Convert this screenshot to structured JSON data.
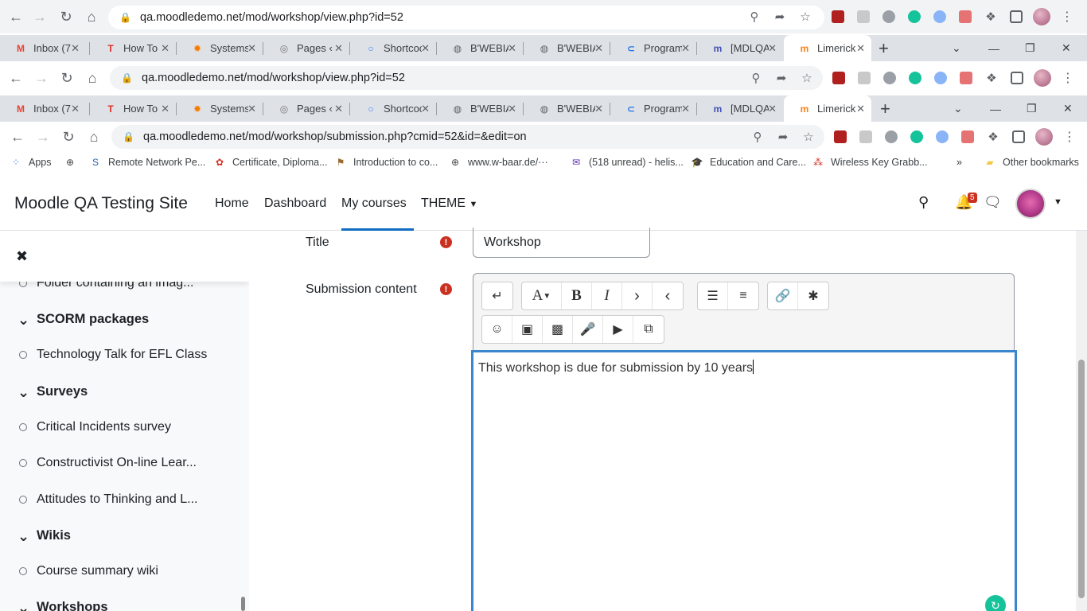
{
  "browser": {
    "row1": {
      "url": "qa.moodledemo.net/mod/workshop/view.php?id=52"
    },
    "row2": {
      "url": "qa.moodledemo.net/mod/workshop/view.php?id=52"
    },
    "row3": {
      "url": "qa.moodledemo.net/mod/workshop/submission.php?cmid=52&id=&edit=on"
    },
    "tabs": [
      "Inbox (7",
      "How To",
      "Systems",
      "Pages ‹",
      "Shortcoc",
      "B'WEBIA",
      "B'WEBIA",
      "Program",
      "[MDLQA",
      "Limerick"
    ],
    "tab_icons": [
      "gmail-icon",
      "t-icon",
      "gear-icon",
      "pages-icon",
      "search-icon",
      "globe-icon",
      "globe-icon",
      "link-icon",
      "mdl-icon",
      "moodle-icon"
    ],
    "bookmarks": [
      {
        "label": "Apps",
        "icon": "apps-grid-icon"
      },
      {
        "label": "",
        "icon": "globe-icon"
      },
      {
        "label": "Remote Network Pe...",
        "icon": "s-icon"
      },
      {
        "label": "Certificate, Diploma...",
        "icon": "certificate-icon"
      },
      {
        "label": "Introduction to co...",
        "icon": "intro-icon"
      },
      {
        "label": "www.w-baar.de/···",
        "icon": "globe-icon"
      },
      {
        "label": "(518 unread) - helis...",
        "icon": "mail-icon"
      },
      {
        "label": "Education and Care...",
        "icon": "graduation-cap-icon"
      },
      {
        "label": "Wireless Key Grabb...",
        "icon": "dots-icon"
      },
      {
        "label": "»",
        "icon": ""
      },
      {
        "label": "Other bookmarks",
        "icon": "folder-icon"
      }
    ]
  },
  "moodle": {
    "site_name": "Moodle QA Testing Site",
    "nav": [
      "Home",
      "Dashboard",
      "My courses",
      "THEME"
    ],
    "active_nav": "My courses",
    "notification_count": "5"
  },
  "drawer": {
    "items": [
      {
        "type": "item",
        "label": "Folder containing an imag..."
      },
      {
        "type": "section",
        "label": "SCORM packages"
      },
      {
        "type": "item",
        "label": "Technology Talk for EFL Class"
      },
      {
        "type": "section",
        "label": "Surveys"
      },
      {
        "type": "item",
        "label": "Critical Incidents survey"
      },
      {
        "type": "item",
        "label": "Constructivist On-line Lear..."
      },
      {
        "type": "item",
        "label": "Attitudes to Thinking and L..."
      },
      {
        "type": "section",
        "label": "Wikis"
      },
      {
        "type": "item",
        "label": "Course summary wiki"
      },
      {
        "type": "section",
        "label": "Workshops"
      }
    ]
  },
  "form": {
    "title_label": "Title",
    "title_value": "Workshop",
    "content_label": "Submission content",
    "content_text": "This workshop is due for submission by 10 years",
    "toolbar_row1": [
      [
        "collapse-toolbar-icon"
      ],
      [
        "font-style-icon",
        "bold-icon",
        "italic-icon",
        "indent-icon",
        "outdent-icon"
      ],
      [
        "unordered-list-icon",
        "ordered-list-icon"
      ],
      [
        "link-icon",
        "unlink-icon"
      ]
    ],
    "toolbar_row2": [
      "emoji-icon",
      "image-icon",
      "media-icon",
      "record-audio-icon",
      "record-video-icon",
      "manage-files-icon"
    ]
  }
}
